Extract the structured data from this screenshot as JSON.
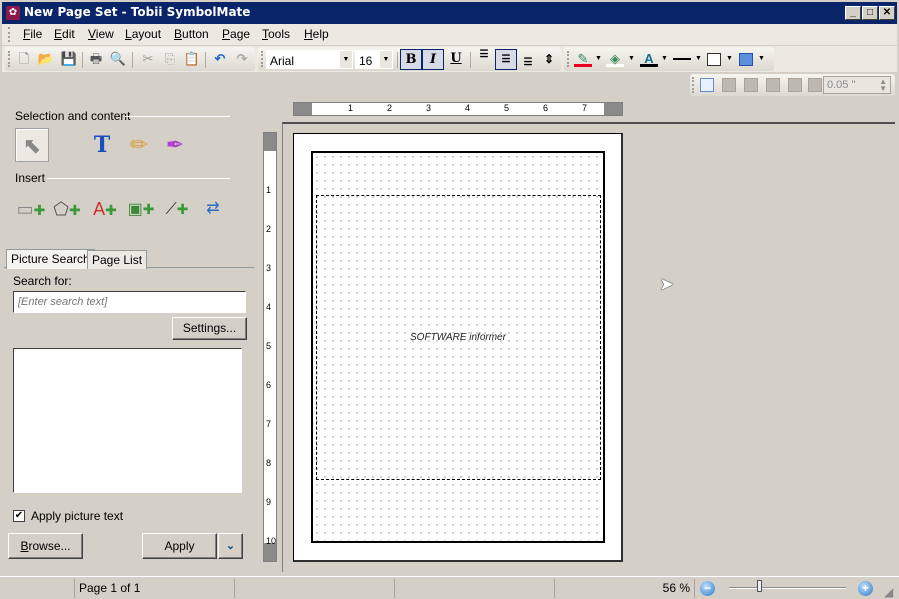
{
  "window": {
    "title": "New Page Set - Tobii SymbolMate",
    "controls": {
      "minimize": "_",
      "maximize": "□",
      "close": "✕"
    }
  },
  "menubar": {
    "items": [
      {
        "label": "File",
        "accel": "F"
      },
      {
        "label": "Edit",
        "accel": "E"
      },
      {
        "label": "View",
        "accel": "V"
      },
      {
        "label": "Layout",
        "accel": "L"
      },
      {
        "label": "Button",
        "accel": "B"
      },
      {
        "label": "Page",
        "accel": "P"
      },
      {
        "label": "Tools",
        "accel": "T"
      },
      {
        "label": "Help",
        "accel": "H"
      }
    ]
  },
  "toolbar": {
    "icons": [
      "new-page-icon",
      "open-folder-icon",
      "save-icon",
      "print-icon",
      "print-preview-icon",
      "cut-icon",
      "copy-icon",
      "paste-icon",
      "undo-icon",
      "redo-icon"
    ],
    "font_name": "Arial",
    "font_size": "16",
    "bold": "B",
    "italic": "I",
    "underline": "U",
    "bold_active": true,
    "italic_active": true,
    "align_center_active": true,
    "colors": {
      "line_color": "#e8001c",
      "fill_color": "#ffffff",
      "text_color": "#000000",
      "border_fill": "#5b8fe0"
    }
  },
  "toolbar2": {
    "spacing_value": "0.05 \""
  },
  "leftpanel": {
    "selection_label": "Selection and content",
    "insert_label": "Insert",
    "selection_tools": [
      "pointer-icon",
      "text-tool-icon",
      "pencil-icon",
      "eyedropper-icon"
    ],
    "insert_tools": [
      "insert-button-icon",
      "insert-freeform-button-icon",
      "insert-text-icon",
      "insert-picture-icon",
      "insert-line-icon",
      "move-button-icon"
    ],
    "tabs": [
      {
        "label": "Picture Search",
        "active": true
      },
      {
        "label": "Page List",
        "active": false
      }
    ],
    "search_label": "Search for:",
    "search_placeholder": "[Enter search text]",
    "search_value": "",
    "settings_label": "Settings...",
    "apply_picture_text_label": "Apply picture text",
    "apply_picture_text_checked": true,
    "browse_label": "Browse...",
    "apply_label": "Apply"
  },
  "canvas": {
    "hruler_labels": [
      "1",
      "2",
      "3",
      "4",
      "5",
      "6",
      "7"
    ],
    "vruler_labels": [
      "1",
      "2",
      "3",
      "4",
      "5",
      "6",
      "7",
      "8",
      "9",
      "10"
    ],
    "watermark_text": "SOFTWARE informer"
  },
  "statusbar": {
    "page_info": "Page 1 of 1",
    "zoom_level": "56 %",
    "zoom_slider_fraction": 0.26
  }
}
